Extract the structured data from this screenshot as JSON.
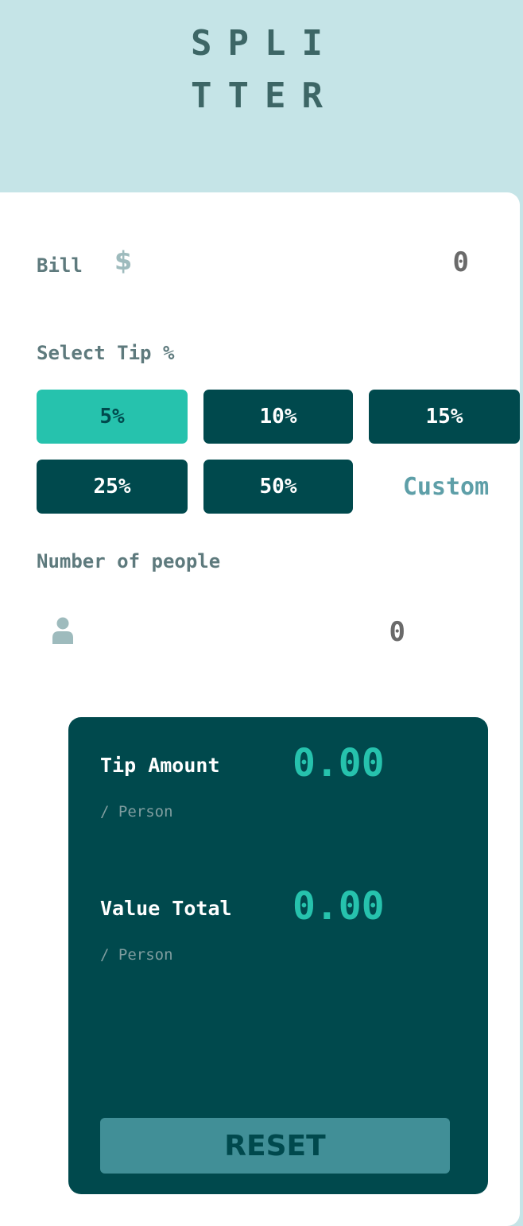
{
  "logo": {
    "line1": "SPLI",
    "line2": "TTER"
  },
  "bill": {
    "label": "Bill",
    "currency_icon": "dollar-icon",
    "currency_symbol": "$",
    "value": "0"
  },
  "tip": {
    "label": "Select Tip %",
    "options": [
      "5%",
      "10%",
      "15%",
      "25%",
      "50%"
    ],
    "selected": "5%",
    "custom_placeholder": "Custom"
  },
  "people": {
    "label": "Number of people",
    "icon": "person-icon",
    "value": "0"
  },
  "results": {
    "tip_amount_label": "Tip Amount",
    "tip_amount_sub": "/ Person",
    "tip_amount_value": "0.00",
    "total_label": "Value Total",
    "total_sub": "/ Person",
    "total_value": "0.00",
    "reset_label": "RESET"
  },
  "colors": {
    "background": "#c5e4e7",
    "dark_cyan": "#00494d",
    "strong_cyan": "#26c2ad",
    "reset_button": "#418f97",
    "logo_text": "#3d6666"
  }
}
